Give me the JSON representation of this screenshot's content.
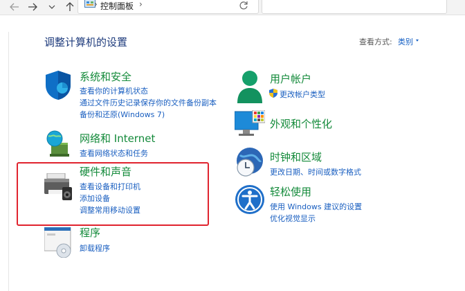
{
  "address_bar": {
    "location": "控制面板",
    "separator": "›"
  },
  "search": {
    "placeholder": ""
  },
  "page_title": "调整计算机的设置",
  "view_by": {
    "label": "查看方式:",
    "value": "类别"
  },
  "categories": [
    {
      "title": "系统和安全",
      "links": [
        "查看你的计算机状态",
        "通过文件历史记录保存你的文件备份副本",
        "备份和还原(Windows 7)"
      ]
    },
    {
      "title": "网络和 Internet",
      "links": [
        "查看网络状态和任务"
      ]
    },
    {
      "title": "硬件和声音",
      "links": [
        "查看设备和打印机",
        "添加设备",
        "调整常用移动设置"
      ]
    },
    {
      "title": "程序",
      "links": [
        "卸载程序"
      ]
    },
    {
      "title": "用户帐户",
      "links": [
        "更改帐户类型"
      ]
    },
    {
      "title": "外观和个性化",
      "links": []
    },
    {
      "title": "时钟和区域",
      "links": [
        "更改日期、时间或数字格式"
      ]
    },
    {
      "title": "轻松使用",
      "links": [
        "使用 Windows 建议的设置",
        "优化视觉显示"
      ]
    }
  ],
  "colors": {
    "title_green": "#138a3a",
    "link_blue": "#1a5fc0",
    "heading_blue": "#1e3b7c",
    "highlight_red": "#e0232e"
  }
}
